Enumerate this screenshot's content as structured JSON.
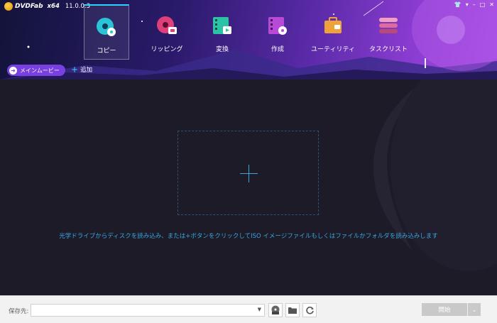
{
  "app": {
    "brand": "DVDFab",
    "arch": "x64",
    "version": "11.0.0.3"
  },
  "nav": [
    {
      "label": "コピー",
      "icon": "copy-disc-icon",
      "active": true
    },
    {
      "label": "リッピング",
      "icon": "ripper-disc-icon"
    },
    {
      "label": "変換",
      "icon": "converter-film-icon"
    },
    {
      "label": "作成",
      "icon": "creator-film-icon"
    },
    {
      "label": "ユーティリティ",
      "icon": "toolbox-icon"
    },
    {
      "label": "タスクリスト",
      "icon": "task-list-icon"
    }
  ],
  "toolbar": {
    "main_movie": "メインムービー",
    "add": "追加"
  },
  "content": {
    "hint": "光学ドライブからディスクを読み込み、または+ボタンをクリックしてISO イメージファイルもしくはファイルかフォルダを読み込みします"
  },
  "bottom": {
    "save_label": "保存先:",
    "save_value": "",
    "start": "開始"
  },
  "colors": {
    "accent": "#2fd0ff",
    "header_start": "#12143a",
    "header_end": "#a44ce0",
    "hint": "#3aa6e0"
  }
}
